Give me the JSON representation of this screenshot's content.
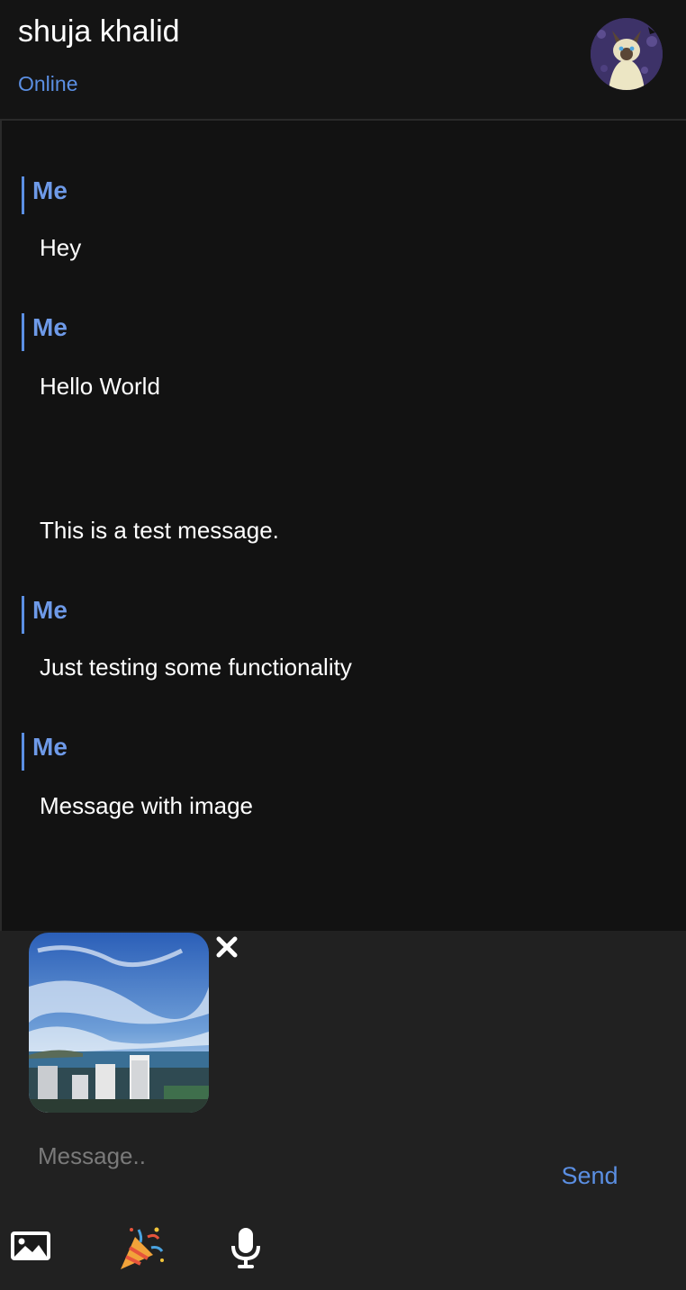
{
  "header": {
    "contact_name": "shuja khalid",
    "status": "Online",
    "avatar_icon": "siamese-cat-avatar"
  },
  "messages": [
    {
      "sender": "Me",
      "text": "Hey"
    },
    {
      "sender": "Me",
      "text": "Hello World"
    },
    {
      "sender": "",
      "text": "This is a test message."
    },
    {
      "sender": "Me",
      "text": "Just testing some functionality"
    },
    {
      "sender": "Me",
      "text": "Message with image"
    }
  ],
  "composer": {
    "attachment_icon": "sky-city-photo",
    "remove_icon": "close-icon",
    "placeholder": "Message..",
    "send_label": "Send"
  },
  "toolbar": {
    "image_icon": "image-icon",
    "party_icon": "party-popper-icon",
    "mic_icon": "microphone-icon"
  },
  "colors": {
    "accent": "#5b8fe3",
    "background": "#121212",
    "composer_bg": "#212121"
  }
}
